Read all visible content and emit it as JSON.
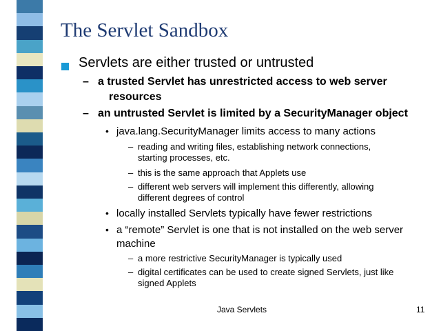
{
  "slide": {
    "title": "The Servlet Sandbox",
    "stripe_colors": [
      "#3c7aa8",
      "#8fbde6",
      "#153f73",
      "#4aa3c8",
      "#e8e6c0",
      "#0e2f66",
      "#2a92c8",
      "#a9d0ee",
      "#5a8fb0",
      "#dedcb0",
      "#1b5b8a",
      "#0c2858",
      "#3a84c0",
      "#b7d9f0",
      "#0f3466",
      "#5ab0d8",
      "#d8d6a8",
      "#1d4c85",
      "#6cb3e0",
      "#0b2452",
      "#2f7eb8",
      "#e4e2b8",
      "#12417a",
      "#88c0e6",
      "#0a2a5c"
    ],
    "bullets": {
      "l1_1": "Servlets are either trusted or untrusted",
      "l2_1a": "a trusted Servlet has unrestricted access to web server",
      "l2_1b": "resources",
      "l2_2": "an untrusted Servlet is limited by a SecurityManager object",
      "l3_1": "java.lang.SecurityManager limits access to many actions",
      "l4_1a": "reading and writing files, establishing network connections,",
      "l4_1b": "starting processes, etc.",
      "l4_2": "this is the same approach that Applets use",
      "l4_3a": "different web servers will implement this differently, allowing",
      "l4_3b": "different degrees of control",
      "l3_2": "locally installed Servlets typically have fewer restrictions",
      "l3_3a": "a “remote” Servlet is one that is not installed on the web server",
      "l3_3b": "machine",
      "l4_4": "a more restrictive SecurityManager is typically used",
      "l4_5a": "digital certificates can be used to create signed Servlets, just like",
      "l4_5b": "signed Applets"
    },
    "markers": {
      "dash": "–",
      "dot": "•"
    },
    "footer": {
      "center": "Java Servlets",
      "page_number": "11"
    }
  }
}
